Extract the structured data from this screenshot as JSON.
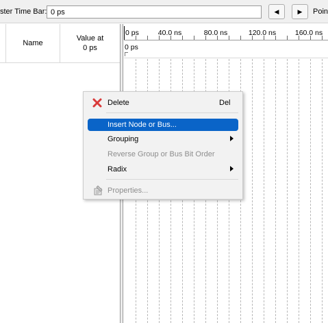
{
  "toolbar": {
    "master_time_bar_label": "ster Time Bar:",
    "master_time_bar_value": "0 ps",
    "prev_icon": "◀",
    "next_icon": "▶",
    "pointer_label": "Point"
  },
  "node_panel": {
    "columns": {
      "name": "Name",
      "value_at_line1": "Value at",
      "value_at_line2": "0 ps"
    }
  },
  "waveform": {
    "ruler_labels": [
      "0 ps",
      "40.0 ns",
      "80.0 ns",
      "120.0 ns",
      "160.0 ns"
    ],
    "cursor_text": "0 ps"
  },
  "context_menu": {
    "items": [
      {
        "label": "Delete",
        "shortcut": "Del",
        "icon": "delete-x-icon",
        "enabled": true
      },
      {
        "label": "Insert Node or Bus...",
        "enabled": true,
        "highlighted": true
      },
      {
        "label": "Grouping",
        "submenu": true,
        "enabled": true
      },
      {
        "label": "Reverse Group or Bus Bit Order",
        "enabled": false
      },
      {
        "label": "Radix",
        "submenu": true,
        "enabled": true
      },
      {
        "label": "Properties...",
        "icon": "properties-icon",
        "enabled": false
      }
    ]
  },
  "colors": {
    "highlight": "#0a64c8",
    "delete_icon": "#d93a3a",
    "disabled_text": "#8d8d8d"
  }
}
